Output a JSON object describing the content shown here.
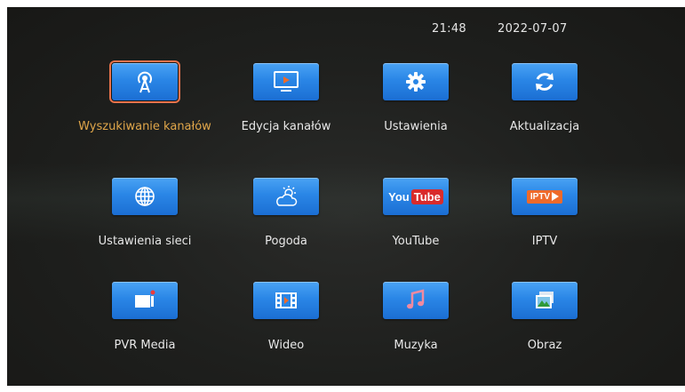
{
  "status": {
    "time": "21:48",
    "date": "2022-07-07"
  },
  "menu": {
    "rows": [
      [
        {
          "label": "Wyszukiwanie kanałów",
          "icon": "antenna-icon",
          "selected": true
        },
        {
          "label": "Edycja kanałów",
          "icon": "tv-screen-icon"
        },
        {
          "label": "Ustawienia",
          "icon": "gear-icon"
        },
        {
          "label": "Aktualizacja",
          "icon": "refresh-icon"
        }
      ],
      [
        {
          "label": "Ustawienia sieci",
          "icon": "globe-icon"
        },
        {
          "label": "Pogoda",
          "icon": "weather-icon"
        },
        {
          "label": "YouTube",
          "icon": "youtube-icon"
        },
        {
          "label": "IPTV",
          "icon": "iptv-icon"
        }
      ],
      [
        {
          "label": "PVR Media",
          "icon": "pvr-camera-icon"
        },
        {
          "label": "Wideo",
          "icon": "film-icon"
        },
        {
          "label": "Muzyka",
          "icon": "music-note-icon"
        },
        {
          "label": "Obraz",
          "icon": "image-icon"
        }
      ]
    ]
  },
  "icon_text": {
    "youtube_you": "You",
    "youtube_tube": "Tube",
    "iptv": "IPTV"
  },
  "colors": {
    "selected_border": "#e8734c",
    "selected_label": "#e0a64a",
    "button_blue": "#2a86e6"
  }
}
